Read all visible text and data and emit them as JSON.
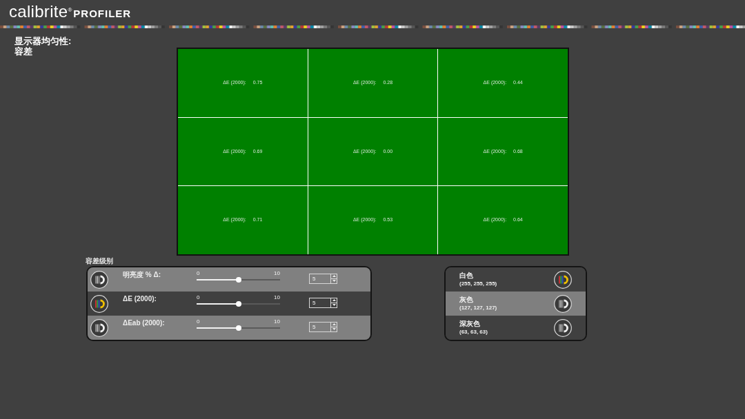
{
  "logo": {
    "brand": "calibrite",
    "registered": "®",
    "product": "PROFILER"
  },
  "title": "显示器均匀性:",
  "subtitle": "容差",
  "grid": {
    "cells": [
      {
        "label": "ΔE (2000):",
        "value": "0.75",
        "pass": true
      },
      {
        "label": "ΔE (2000):",
        "value": "0.28",
        "pass": true
      },
      {
        "label": "ΔE (2000):",
        "value": "0.44",
        "pass": true
      },
      {
        "label": "ΔE (2000):",
        "value": "0.69",
        "pass": true
      },
      {
        "label": "ΔE (2000):",
        "value": "0.00",
        "pass": true
      },
      {
        "label": "ΔE (2000):",
        "value": "0.68",
        "pass": true
      },
      {
        "label": "ΔE (2000):",
        "value": "0.71",
        "pass": true
      },
      {
        "label": "ΔE (2000):",
        "value": "0.53",
        "pass": true
      },
      {
        "label": "ΔE (2000):",
        "value": "0.64",
        "pass": true
      }
    ]
  },
  "tolerance_levels": {
    "title": "容差级别",
    "rows": [
      {
        "label": "明亮度 % Δ:",
        "selected": false,
        "highlighted": true,
        "min_label": "0",
        "max_label": "10",
        "level": 0.5,
        "value": "5"
      },
      {
        "label": "ΔE (2000):",
        "selected": true,
        "highlighted": false,
        "min_label": "0",
        "max_label": "10",
        "level": 0.5,
        "value": "5"
      },
      {
        "label": "ΔEab (2000):",
        "selected": false,
        "highlighted": true,
        "min_label": "0",
        "max_label": "10",
        "level": 0.5,
        "value": "5"
      }
    ]
  },
  "reference_colors": {
    "rows": [
      {
        "name": "白色",
        "rgb": "(255, 255, 255)",
        "selected": true,
        "highlighted": false
      },
      {
        "name": "灰色",
        "rgb": "(127, 127, 127)",
        "selected": false,
        "highlighted": true
      },
      {
        "name": "深灰色",
        "rgb": "(63, 63, 63)",
        "selected": false,
        "highlighted": false
      }
    ]
  }
}
